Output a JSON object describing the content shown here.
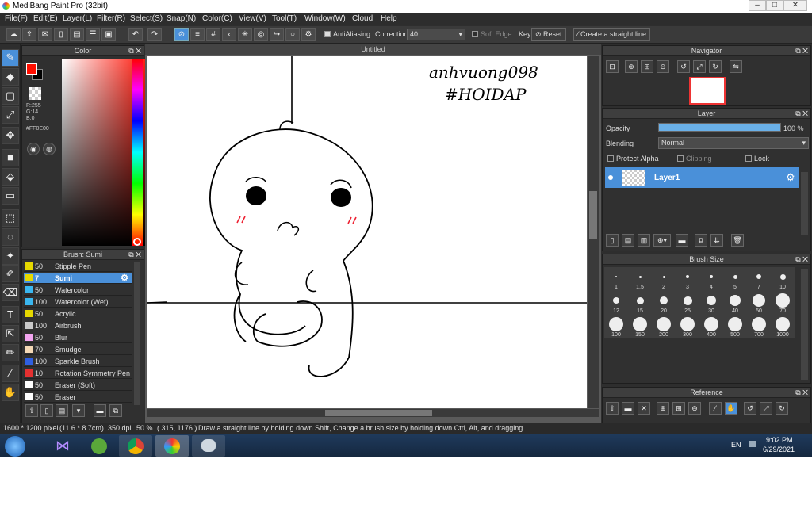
{
  "window": {
    "title": "MediBang Paint Pro (32bit)"
  },
  "menu": [
    "File(F)",
    "Edit(E)",
    "Layer(L)",
    "Filter(R)",
    "Select(S)",
    "Snap(N)",
    "Color(C)",
    "View(V)",
    "Tool(T)",
    "Window(W)",
    "Cloud",
    "Help"
  ],
  "toolbar": {
    "antialiasing_label": "AntiAliasing",
    "correction_label": "Correction",
    "correction_value": "40",
    "soft_edge_label": "Soft Edge",
    "key_label": "Key",
    "reset_label": "Reset",
    "straight_line_label": "Create a straight line"
  },
  "color_panel": {
    "title": "Color",
    "r": "R:255",
    "g": "G:14",
    "b": "B:0",
    "hex": "#FF0E00",
    "primary": "#ff0e00",
    "secondary": "#000000"
  },
  "brush_panel": {
    "title": "Brush: Sumi",
    "items": [
      {
        "size": "50",
        "name": "Stipple Pen",
        "color": "#e6d800"
      },
      {
        "size": "7",
        "name": "Sumi",
        "color": "#e6d800",
        "selected": true
      },
      {
        "size": "50",
        "name": "Watercolor",
        "color": "#3ab7f0"
      },
      {
        "size": "100",
        "name": "Watercolor (Wet)",
        "color": "#3ab7f0"
      },
      {
        "size": "50",
        "name": "Acrylic",
        "color": "#e6d800"
      },
      {
        "size": "100",
        "name": "Airbrush",
        "color": "#c8c8c8"
      },
      {
        "size": "50",
        "name": "Blur",
        "color": "#f3a6f0"
      },
      {
        "size": "70",
        "name": "Smudge",
        "color": "#f4d9b6"
      },
      {
        "size": "100",
        "name": "Sparkle Brush",
        "color": "#2f5fe0"
      },
      {
        "size": "10",
        "name": "Rotation Symmetry Pen",
        "color": "#e53030"
      },
      {
        "size": "50",
        "name": "Eraser (Soft)",
        "color": "#ffffff"
      },
      {
        "size": "50",
        "name": "Eraser",
        "color": "#ffffff"
      }
    ]
  },
  "canvas": {
    "tab": "Untitled",
    "handwriting1": "anhvuong098",
    "handwriting2": "#HOIDAP"
  },
  "navigator": {
    "title": "Navigator"
  },
  "layer_panel": {
    "title": "Layer",
    "opacity_label": "Opacity",
    "opacity_value": "100 %",
    "opacity_fraction": 1.0,
    "blending_label": "Blending",
    "blending_value": "Normal",
    "protect_alpha": "Protect Alpha",
    "clipping": "Clipping",
    "lock": "Lock",
    "layer_name": "Layer1"
  },
  "brush_size": {
    "title": "Brush Size",
    "sizes": [
      "1",
      "1.5",
      "2",
      "3",
      "4",
      "5",
      "7",
      "10",
      "12",
      "15",
      "20",
      "25",
      "30",
      "40",
      "50",
      "70",
      "100",
      "150",
      "200",
      "300",
      "400",
      "500",
      "700",
      "1000"
    ]
  },
  "reference": {
    "title": "Reference"
  },
  "status": {
    "dimensions": "1600 * 1200 pixel",
    "cm": "(11.6 * 8.7cm)",
    "dpi": "350 dpi",
    "zoom": "50 %",
    "coords": "( 315, 1176 )",
    "hint": "Draw a straight line by holding down Shift, Change a brush size by holding down Ctrl, Alt, and dragging"
  },
  "taskbar": {
    "lang": "EN",
    "time": "9:02 PM",
    "date": "6/29/2021"
  }
}
